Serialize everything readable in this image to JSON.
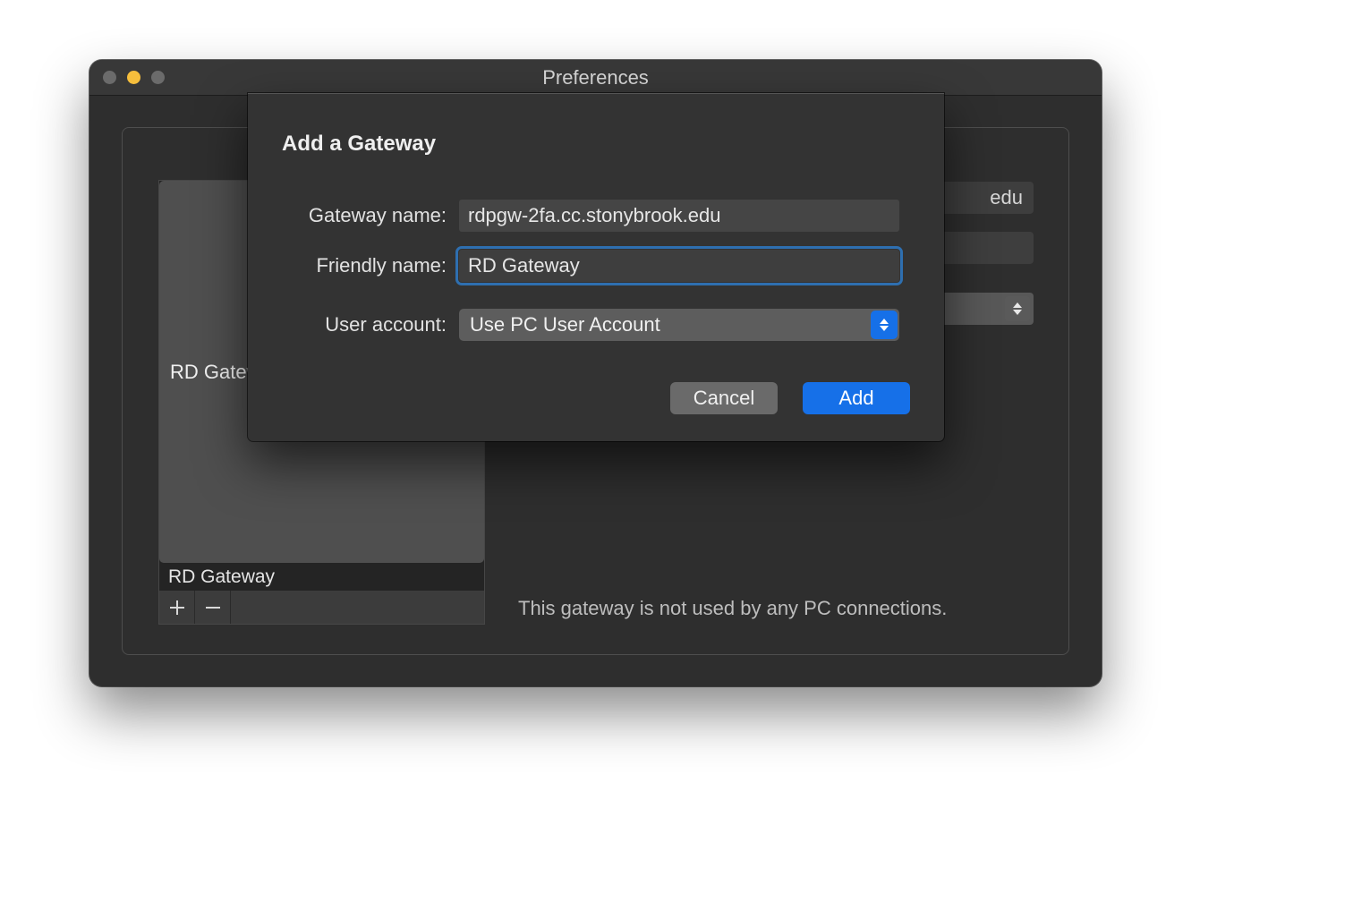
{
  "window": {
    "title": "Preferences",
    "sidebar": {
      "items": [
        {
          "label": "RD Gateway",
          "selected": true
        },
        {
          "label": "RD Gateway",
          "selected": false
        }
      ]
    },
    "bg_fields": {
      "server_suffix": "edu"
    },
    "status": "This gateway is not used by any PC connections."
  },
  "sheet": {
    "title": "Add a Gateway",
    "labels": {
      "gateway": "Gateway name:",
      "friendly": "Friendly name:",
      "user": "User account:"
    },
    "gateway_name": "rdpgw-2fa.cc.stonybrook.edu",
    "friendly_name": "RD Gateway",
    "user_account": "Use PC User Account",
    "buttons": {
      "cancel": "Cancel",
      "add": "Add"
    }
  }
}
